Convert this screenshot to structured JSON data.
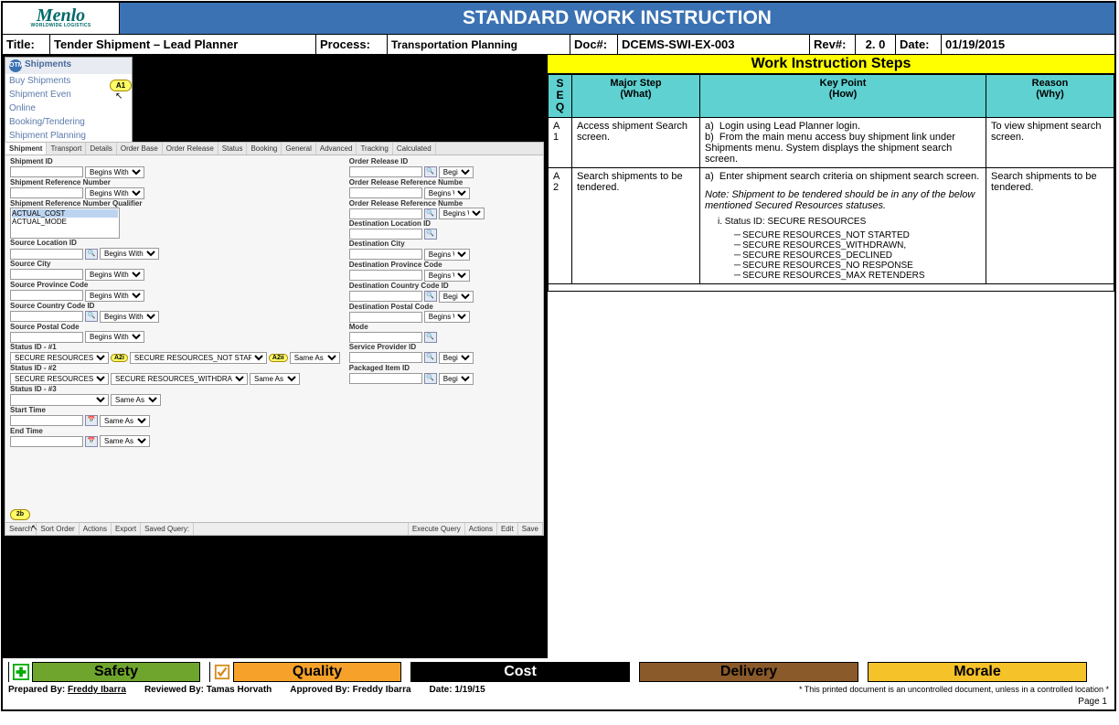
{
  "banner_title": "STANDARD WORK INSTRUCTION",
  "logo": {
    "text": "Menlo",
    "sub": "WORLDWIDE LOGISTICS"
  },
  "info": {
    "title_label": "Title:",
    "title_val": "Tender Shipment – Lead Planner",
    "process_label": "Process:",
    "process_val": "Transportation Planning",
    "doc_label": "Doc#:",
    "doc_val": "DCEMS-SWI-EX-003",
    "rev_label": "Rev#:",
    "rev_val": "2. 0",
    "date_label": "Date:",
    "date_val": "01/19/2015"
  },
  "wis_title": "Work Instruction Steps",
  "headers": {
    "seq": "S E Q",
    "major": "Major Step (What)",
    "key": "Key Point (How)",
    "reason": "Reason (Why)"
  },
  "steps": [
    {
      "seq": "A 1",
      "major": "Access shipment Search screen.",
      "key_a": "Login using Lead Planner login.",
      "key_b": "From the main menu access buy shipment link  under Shipments menu. System displays the shipment search screen.",
      "reason": "To view shipment search screen."
    },
    {
      "seq": "A 2",
      "major": "Search shipments to be tendered.",
      "key_a": "Enter shipment search criteria on shipment search screen.",
      "note": "Note: Shipment to be tendered should be in any of the below mentioned Secured Resources statuses.",
      "status_hdr": "i.  Status ID: SECURE RESOURCES",
      "statuses": [
        "SECURE RESOURCES_NOT STARTED",
        "SECURE RESOURCES_WITHDRAWN,",
        "SECURE RESOURCES_DECLINED",
        "SECURE RESOURCES_NO RESPONSE",
        "SECURE RESOURCES_MAX RETENDERS"
      ],
      "reason": "Search shipments to be tendered."
    }
  ],
  "screenshot": {
    "menu_hdr": "Shipments",
    "menu_items": [
      "Buy Shipments",
      "Shipment Even",
      "Online",
      "Booking/Tendering",
      "Shipment Planning"
    ],
    "callout_a1": "A1",
    "tabs": [
      "Shipment",
      "Transport",
      "Details",
      "Order Base",
      "Order Release",
      "Status",
      "Booking",
      "General",
      "Advanced",
      "Tracking",
      "Calculated"
    ],
    "left_fields": [
      {
        "label": "Shipment ID",
        "op": "Begins With"
      },
      {
        "label": "Shipment Reference Number",
        "op": "Begins With"
      },
      {
        "label": "Shipment Reference Number Qualifier"
      },
      {
        "label": "Source Location ID",
        "op": "Begins With"
      },
      {
        "label": "Source City",
        "op": "Begins With"
      },
      {
        "label": "Source Province Code",
        "op": "Begins With"
      },
      {
        "label": "Source Country Code ID",
        "op": "Begins With"
      },
      {
        "label": "Source Postal Code",
        "op": "Begins With"
      },
      {
        "label": "Status ID - #1"
      },
      {
        "label": "Status ID - #2"
      },
      {
        "label": "Status ID - #3"
      },
      {
        "label": "Start Time",
        "op": "Same As"
      },
      {
        "label": "End Time",
        "op": "Same As"
      }
    ],
    "right_fields": [
      {
        "label": "Order Release ID",
        "op": "Begin"
      },
      {
        "label": "Order Release Reference Numbe",
        "op": "Begins W"
      },
      {
        "label": "Order Release Reference Numbe",
        "op": "Begins W"
      },
      {
        "label": "Destination Location ID"
      },
      {
        "label": "Destination City",
        "op": "Begins W"
      },
      {
        "label": "Destination Province Code",
        "op": "Begins W"
      },
      {
        "label": "Destination Country Code ID",
        "op": "Begin"
      },
      {
        "label": "Destination Postal Code",
        "op": "Begins W"
      },
      {
        "label": "Mode"
      },
      {
        "label": "Service Provider ID",
        "op": "Begin"
      },
      {
        "label": "Packaged Item ID",
        "op": "Begin"
      }
    ],
    "qualifier_options": [
      "ACTUAL_COST",
      "ACTUAL_MODE"
    ],
    "status1_a": "SECURE RESOURCES",
    "status1_b": "SECURE RESOURCES_NOT STARTED",
    "status2_a": "SECURE RESOURCES",
    "status2_b": "SECURE RESOURCES_WITHDRAWN",
    "callout_a2i": "A2i",
    "callout_a2ii": "A2ii",
    "same_as": "Same As",
    "actions": [
      "Search",
      "Sort Order",
      "Actions",
      "Export",
      "Saved Query:",
      "",
      "Execute Query",
      "Actions",
      "Edit",
      "Save"
    ],
    "callout_2b": "2b"
  },
  "badges": {
    "safety": "Safety",
    "quality": "Quality",
    "cost": "Cost",
    "delivery": "Delivery",
    "morale": "Morale"
  },
  "sig": {
    "prepared": "Prepared By: ",
    "prepared_name": "Freddy Ibarra",
    "reviewed": "Reviewed By: Tamas Horvath",
    "approved": "Approved By: Freddy Ibarra",
    "date": "Date: 1/19/15",
    "disclaimer": "* This printed document is an uncontrolled document, unless in a controlled location *",
    "page": "Page 1"
  }
}
